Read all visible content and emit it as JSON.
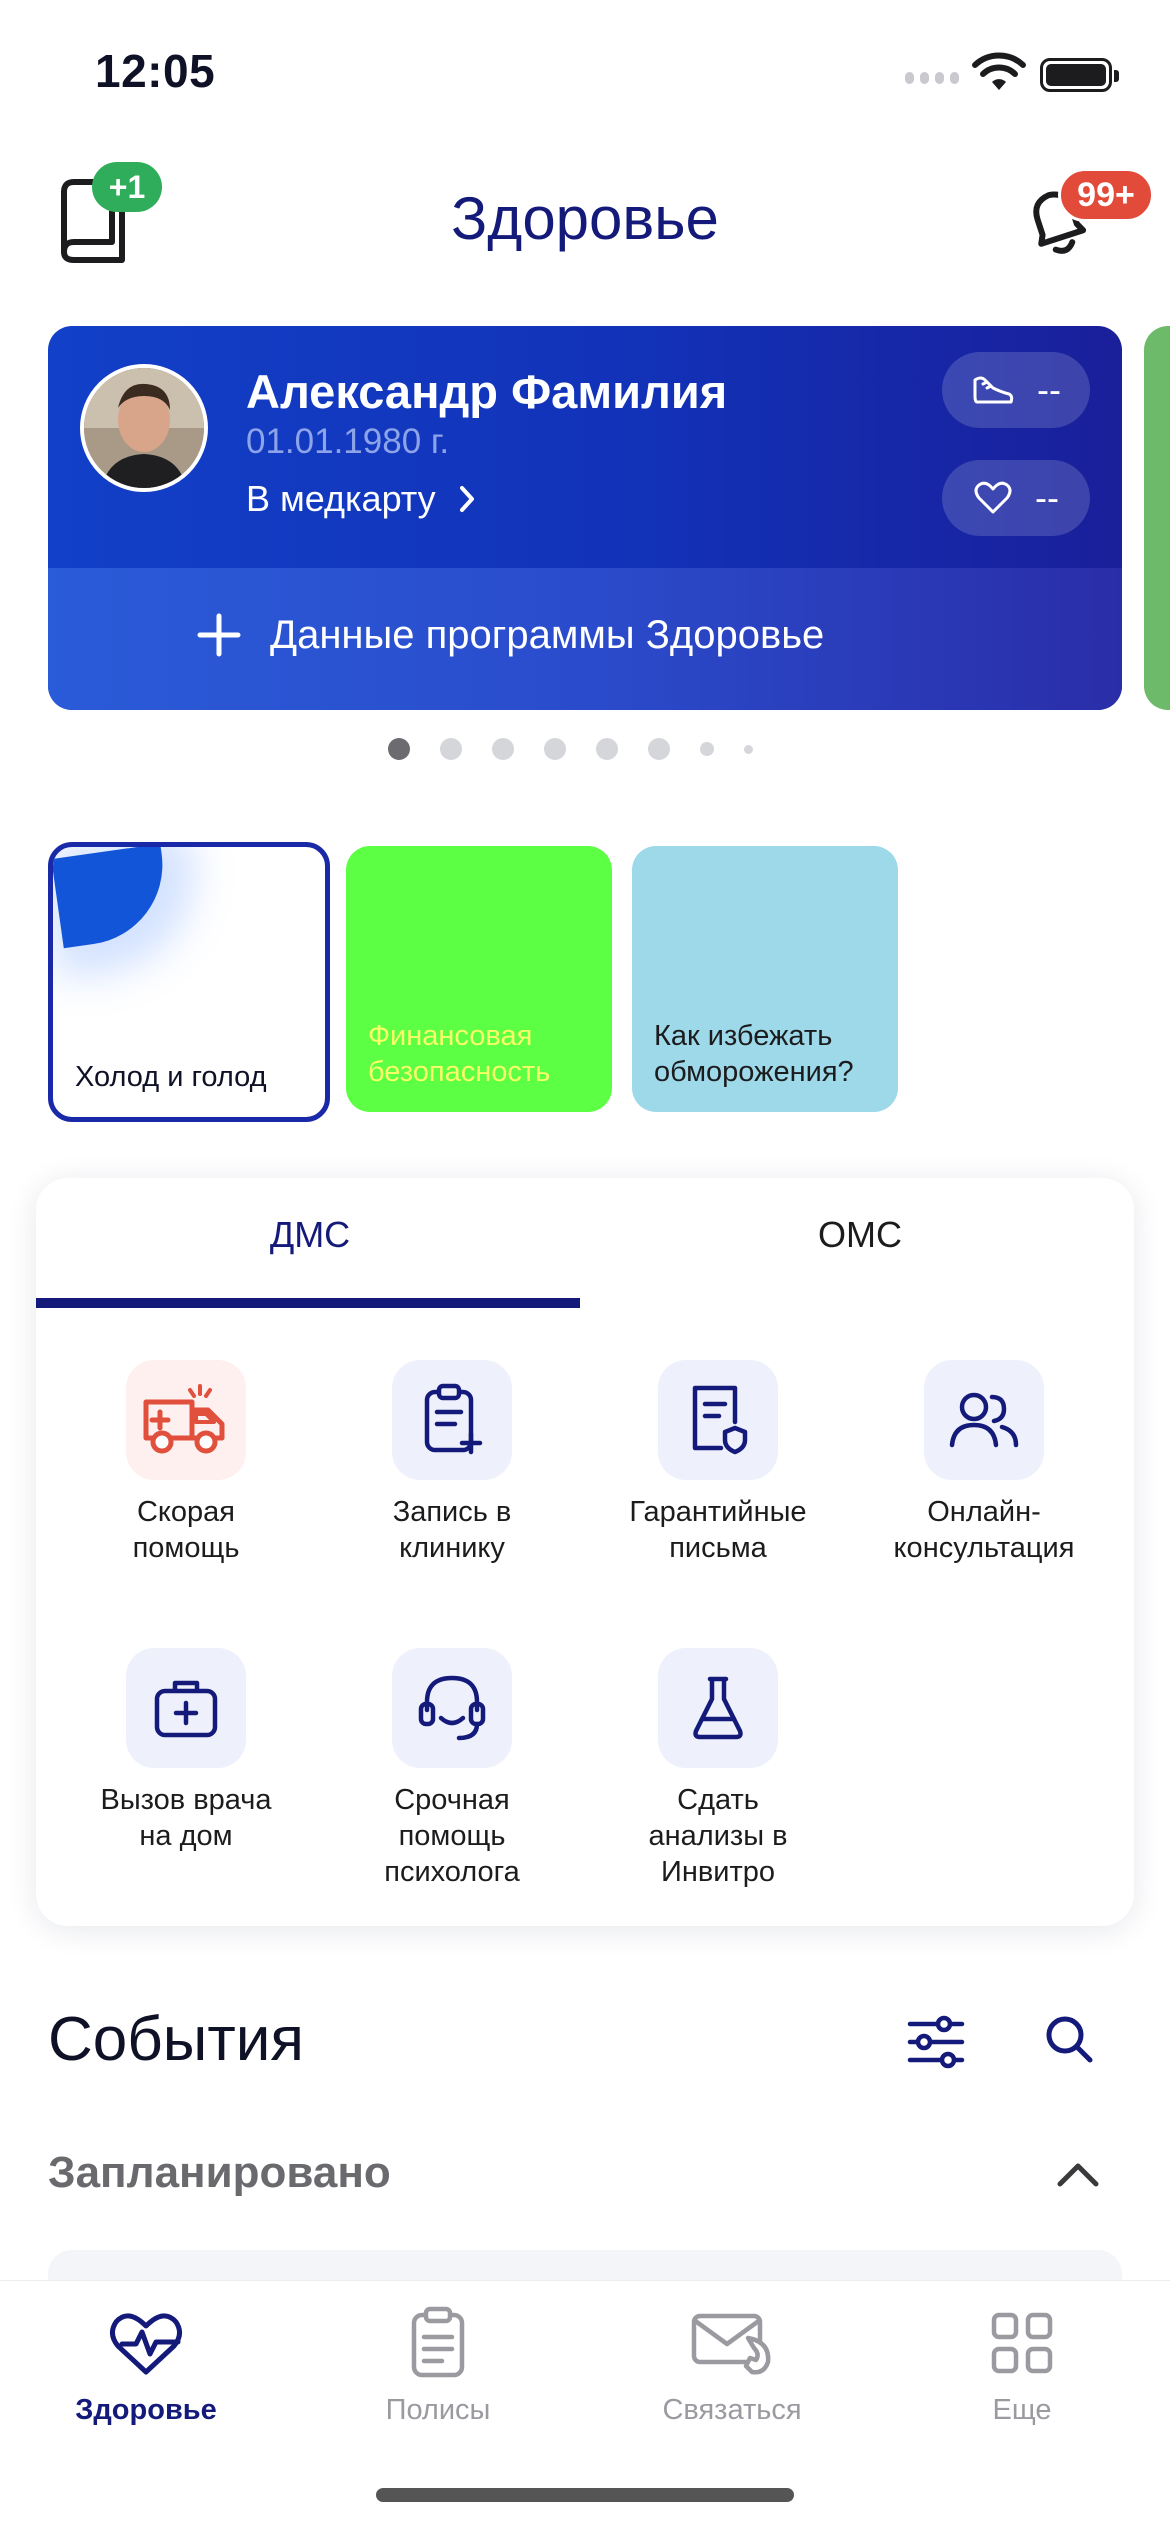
{
  "status_bar": {
    "time": "12:05"
  },
  "header": {
    "title": "Здоровье",
    "book_badge": "+1",
    "notifications_badge": "99+"
  },
  "profile": {
    "name": "Александр Фамилия",
    "dob": "01.01.1980 г.",
    "medcard_link": "В медкарту",
    "steps_value": "--",
    "heart_value": "--",
    "program_link": "Данные программы Здоровье"
  },
  "pagination": {
    "total": 8,
    "active": 1
  },
  "stories": [
    {
      "caption": "Холод и голод"
    },
    {
      "caption": "Финансовая безопасность"
    },
    {
      "caption": "Как избежать обморожения?"
    }
  ],
  "services": {
    "tabs": [
      {
        "label": "ДМС"
      },
      {
        "label": "ОМС"
      }
    ],
    "items": [
      {
        "label": "Скорая помощь",
        "icon": "ambulance-icon"
      },
      {
        "label": "Запись в клинику",
        "icon": "clipboard-add-icon"
      },
      {
        "label": "Гарантийные письма",
        "icon": "document-shield-icon"
      },
      {
        "label": "Онлайн-консультация",
        "icon": "users-icon"
      },
      {
        "label": "Вызов врача на дом",
        "icon": "medkit-icon"
      },
      {
        "label": "Срочная помощь психолога",
        "icon": "headset-icon"
      },
      {
        "label": "Сдать анализы в Инвитро",
        "icon": "flask-icon"
      }
    ]
  },
  "events": {
    "title": "События",
    "planned_title": "Запланировано"
  },
  "bottom_nav": [
    {
      "label": "Здоровье",
      "icon": "heart-pulse-icon",
      "active": true
    },
    {
      "label": "Полисы",
      "icon": "clipboard-icon",
      "active": false
    },
    {
      "label": "Связаться",
      "icon": "envelope-phone-icon",
      "active": false
    },
    {
      "label": "Еще",
      "icon": "grid-icon",
      "active": false
    }
  ],
  "colors": {
    "brand": "#141a7a",
    "card_blue": "#1240c8",
    "badge_green": "#2fad5a",
    "badge_red": "#e24a3a"
  }
}
